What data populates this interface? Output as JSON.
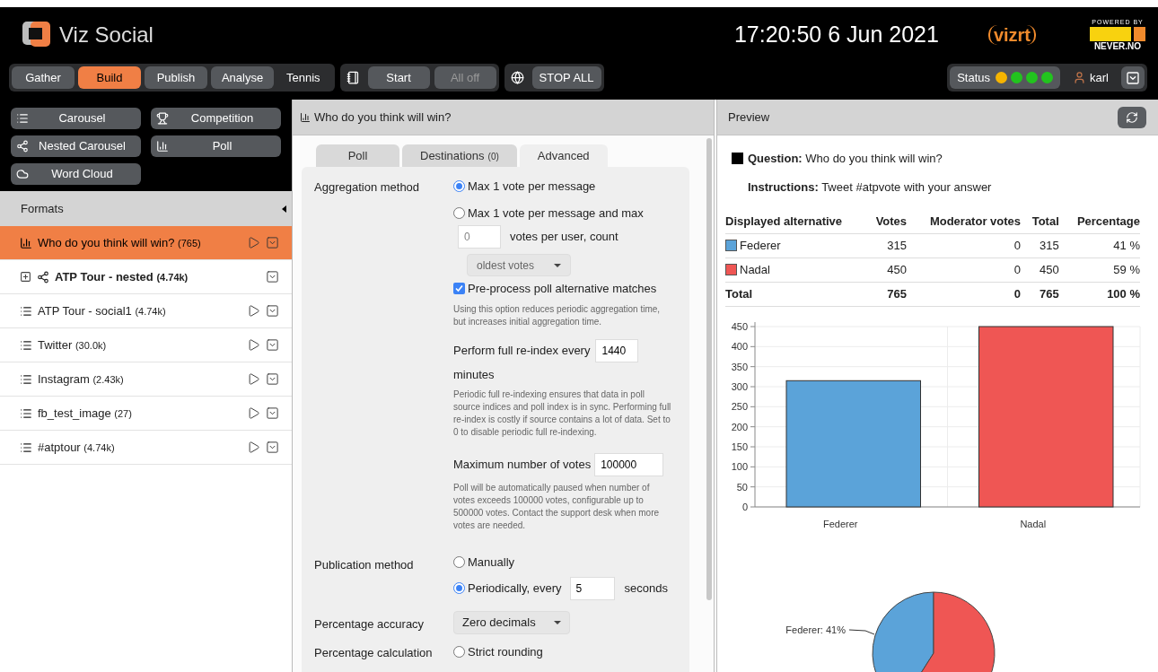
{
  "header": {
    "app_name": "Viz Social",
    "clock": "17:20:50 6 Jun 2021",
    "brand": "vizrt",
    "powered_by": "POWERED BY",
    "partner": "NEVER.NO"
  },
  "nav": {
    "tabs": [
      {
        "label": "Gather",
        "kind": "button",
        "selected": false
      },
      {
        "label": "Build",
        "kind": "button",
        "selected": true
      },
      {
        "label": "Publish",
        "kind": "button",
        "selected": false
      },
      {
        "label": "Analyse",
        "kind": "button",
        "selected": false
      },
      {
        "label": "Tennis",
        "kind": "plain",
        "selected": false
      }
    ],
    "controls": [
      {
        "label": "Start",
        "disabled": false
      },
      {
        "label": "All off",
        "disabled": true
      }
    ],
    "stop_all": "STOP ALL"
  },
  "status": {
    "label": "Status",
    "lights": [
      {
        "color": "#f5b400"
      },
      {
        "color": "#22c41e"
      },
      {
        "color": "#22c41e"
      },
      {
        "color": "#22c41e"
      }
    ],
    "user": "karl"
  },
  "format_types": [
    {
      "kind": "list",
      "label": "Carousel"
    },
    {
      "kind": "trophy",
      "label": "Competition"
    },
    {
      "kind": "nested",
      "label": "Nested Carousel"
    },
    {
      "kind": "poll",
      "label": "Poll"
    },
    {
      "kind": "cloud",
      "label": "Word Cloud"
    }
  ],
  "formats": {
    "title": "Formats",
    "items": [
      {
        "kind": "poll",
        "name": "Who do you think will win?",
        "count": "(765)",
        "selected": true,
        "playable": true,
        "expandable": false
      },
      {
        "kind": "nested",
        "name": "ATP Tour - nested",
        "count": "(4.74k)",
        "selected": false,
        "playable": false,
        "expandable": true
      },
      {
        "kind": "list",
        "name": "ATP Tour - social1",
        "count": "(4.74k)",
        "selected": false,
        "playable": true,
        "expandable": false
      },
      {
        "kind": "list",
        "name": "Twitter",
        "count": "(30.0k)",
        "selected": false,
        "playable": true,
        "expandable": false
      },
      {
        "kind": "list",
        "name": "Instagram",
        "count": "(2.43k)",
        "selected": false,
        "playable": true,
        "expandable": false
      },
      {
        "kind": "list",
        "name": "fb_test_image",
        "count": "(27)",
        "selected": false,
        "playable": true,
        "expandable": false
      },
      {
        "kind": "list",
        "name": "#atptour",
        "count": "(4.74k)",
        "selected": false,
        "playable": true,
        "expandable": false
      }
    ]
  },
  "editor": {
    "title": "Who do you think will win?",
    "tabs": [
      {
        "label": "Poll",
        "selected": false
      },
      {
        "label": "Destinations",
        "count": "(0)",
        "selected": false
      },
      {
        "label": "Advanced",
        "selected": true
      }
    ],
    "aggregation": {
      "label": "Aggregation method",
      "options": [
        {
          "label": "Max 1 vote per message",
          "selected": true
        },
        {
          "label": "Max 1 vote per message and max",
          "selected": false
        }
      ],
      "votes_per_user": {
        "placeholder": "0",
        "suffix": "votes per user, count"
      },
      "count_order": "oldest votes",
      "preprocess": {
        "label": "Pre-process poll alternative matches",
        "checked": true,
        "help": "Using this option reduces periodic aggregation time, but increases initial aggregation time."
      },
      "reindex": {
        "label": "Perform full re-index every",
        "value": "1440",
        "unit": "minutes",
        "help": "Periodic full re-indexing ensures that data in poll source indices and poll index is in sync. Performing full re-index is costly if source contains a lot of data. Set to 0 to disable periodic full re-indexing."
      },
      "max_votes": {
        "label": "Maximum number of votes",
        "value": "100000",
        "help": "Poll will be automatically paused when number of votes exceeds 100000 votes, configurable up to 500000 votes. Contact the support desk when more votes are needed."
      }
    },
    "publication": {
      "label": "Publication method",
      "options": [
        {
          "label": "Manually",
          "selected": false
        },
        {
          "label": "Periodically, every",
          "selected": true
        }
      ],
      "interval": "5",
      "unit": "seconds"
    },
    "accuracy": {
      "label": "Percentage accuracy",
      "value": "Zero decimals"
    },
    "calculation": {
      "label": "Percentage calculation",
      "options": [
        {
          "label": "Strict rounding",
          "selected": false
        }
      ]
    }
  },
  "preview": {
    "title": "Preview",
    "question_label": "Question:",
    "question": "Who do you think will win?",
    "instructions_label": "Instructions:",
    "instructions": "Tweet #atpvote with your answer",
    "table": {
      "columns": [
        "Displayed alternative",
        "Votes",
        "Moderator votes",
        "Total",
        "Percentage"
      ],
      "rows": [
        {
          "color": "#5ba3d9",
          "cells": [
            "Federer",
            "315",
            "0",
            "315",
            "41 %"
          ]
        },
        {
          "color": "#ef5654",
          "cells": [
            "Nadal",
            "450",
            "0",
            "450",
            "59 %"
          ]
        }
      ],
      "total": {
        "cells": [
          "Total",
          "765",
          "0",
          "765",
          "100 %"
        ]
      }
    },
    "bar_chart": {
      "chart_data": {
        "type": "bar",
        "grid": true,
        "series": [
          {
            "name": "Federer",
            "color": "#5ba3d9",
            "values": [
              315,
              null
            ]
          },
          {
            "name": "Nadal",
            "color": "#ef5654",
            "values": [
              null,
              450
            ]
          }
        ],
        "ylim": [
          0,
          450
        ],
        "yticks": [
          0,
          50,
          100,
          150,
          200,
          250,
          300,
          350,
          400,
          450
        ]
      }
    },
    "pie_chart": {
      "chart_data": {
        "type": "pie",
        "values": [
          41,
          59
        ],
        "annotations": [
          "Federer: 41%"
        ]
      }
    }
  }
}
